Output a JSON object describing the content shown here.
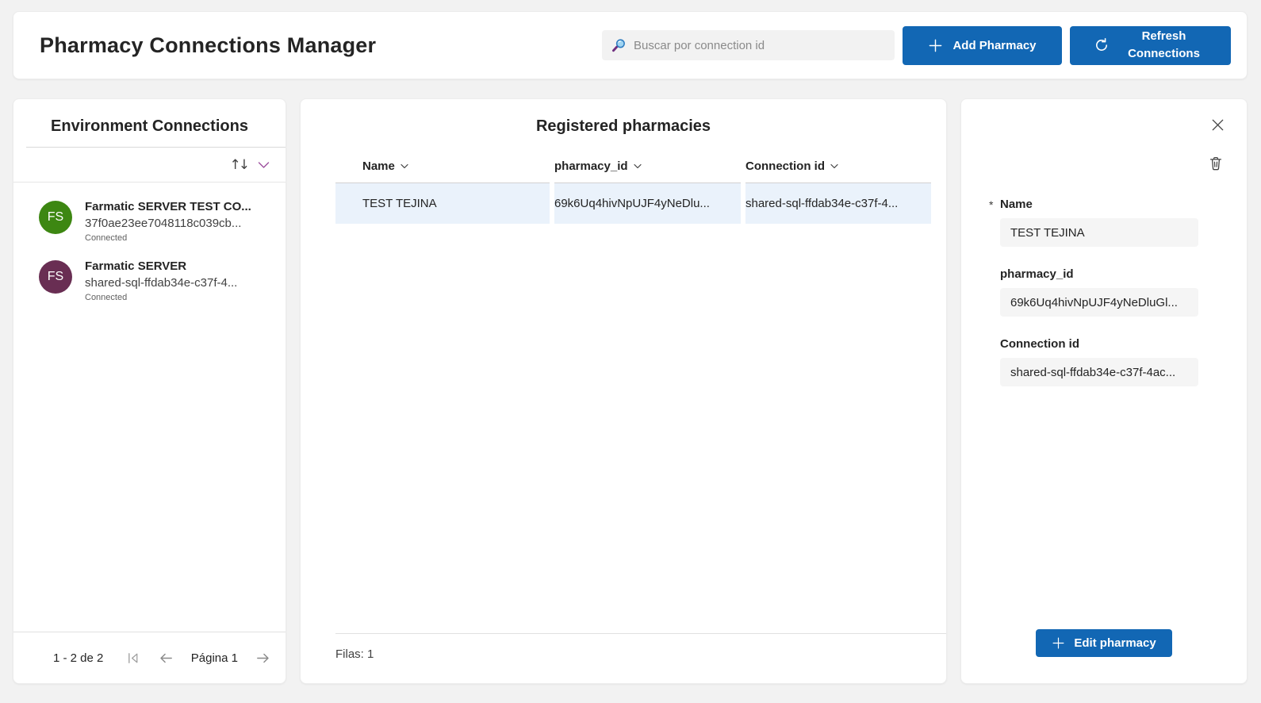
{
  "header": {
    "title": "Pharmacy Connections Manager",
    "search": {
      "placeholder": "Buscar por connection id",
      "value": ""
    },
    "add_button": "Add Pharmacy",
    "refresh_button": "Refresh Connections"
  },
  "colors": {
    "primary_blue": "#1267b4",
    "selected_row": "#eaf2fb",
    "avatar_green": "#3d8712",
    "avatar_plum": "#692e53",
    "sort_chevron_purple": "#9c4f9e"
  },
  "environment_panel": {
    "title": "Environment Connections",
    "connections": [
      {
        "initials": "FS",
        "name": "Farmatic SERVER TEST CO...",
        "id": "37f0ae23ee7048118c039cb...",
        "status": "Connected",
        "color": "#3d8712"
      },
      {
        "initials": "FS",
        "name": "Farmatic SERVER",
        "id": "shared-sql-ffdab34e-c37f-4...",
        "status": "Connected",
        "color": "#692e53"
      }
    ],
    "pagination": {
      "summary": "1 - 2 de 2",
      "page_label": "Página 1"
    }
  },
  "pharmacies_panel": {
    "title": "Registered pharmacies",
    "columns": [
      "Name",
      "pharmacy_id",
      "Connection id"
    ],
    "rows": [
      {
        "name": "TEST TEJINA",
        "pharmacy_id": "69k6Uq4hivNpUJF4yNeDlu...",
        "connection_id": "shared-sql-ffdab34e-c37f-4..."
      }
    ],
    "footer": "Filas: 1"
  },
  "details_panel": {
    "required_marker": "*",
    "name": {
      "label": "Name",
      "value": "TEST TEJINA"
    },
    "pharmacy_id": {
      "label": "pharmacy_id",
      "value": "69k6Uq4hivNpUJF4yNeDluGl..."
    },
    "connection_id": {
      "label": "Connection id",
      "value": "shared-sql-ffdab34e-c37f-4ac..."
    },
    "edit_button": "Edit pharmacy"
  }
}
